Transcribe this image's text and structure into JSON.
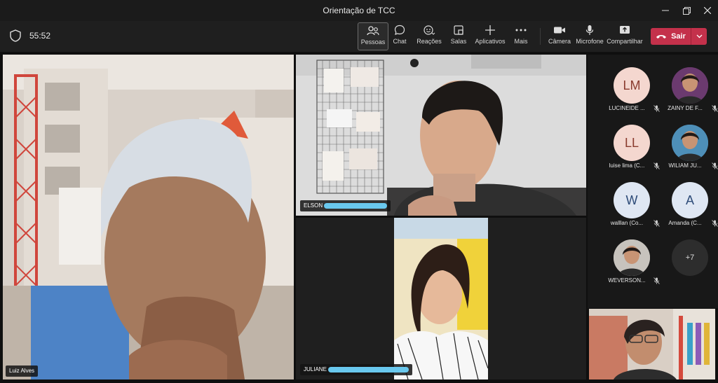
{
  "window": {
    "title": "Orientação de TCC"
  },
  "toolbar": {
    "timer": "55:52",
    "buttons": {
      "pessoas": "Pessoas",
      "chat": "Chat",
      "reacoes": "Reações",
      "salas": "Salas",
      "aplicativos": "Aplicativos",
      "mais": "Mais",
      "camera": "Câmera",
      "microfone": "Microfone",
      "compartilhar": "Compartilhar"
    },
    "leave": "Sair"
  },
  "tiles": {
    "luiz": "Luiz Alves",
    "elson": "ELSON",
    "juliana": "JULIANE"
  },
  "roster": [
    {
      "initials": "LM",
      "name": "LUCINEIDE ...",
      "avatar_bg": "#f4d7cf",
      "avatar_fg": "#8a3b2e"
    },
    {
      "initials": "",
      "name": "ZAINY DE F...",
      "avatar_bg": "#6b3a6f",
      "avatar_fg": "#ffffff"
    },
    {
      "initials": "LL",
      "name": "luise lima (C...",
      "avatar_bg": "#f4d7cf",
      "avatar_fg": "#8a3b2e"
    },
    {
      "initials": "",
      "name": "WILIAM JU...",
      "avatar_bg": "#4e8fb8",
      "avatar_fg": "#ffffff"
    },
    {
      "initials": "W",
      "name": "walllan (Co...",
      "avatar_bg": "#dfe7f3",
      "avatar_fg": "#2d4b78"
    },
    {
      "initials": "A",
      "name": "Amanda (C...",
      "avatar_bg": "#dfe7f3",
      "avatar_fg": "#2d4b78"
    },
    {
      "initials": "",
      "name": "WEVERSON...",
      "avatar_bg": "#c7c3bd",
      "avatar_fg": "#ffffff"
    },
    {
      "initials": "+7",
      "name": "",
      "avatar_bg": "#2d2d2d",
      "avatar_fg": "#dddddd"
    }
  ],
  "colors": {
    "leave": "#c4314b",
    "accent": "#69c8ee"
  }
}
